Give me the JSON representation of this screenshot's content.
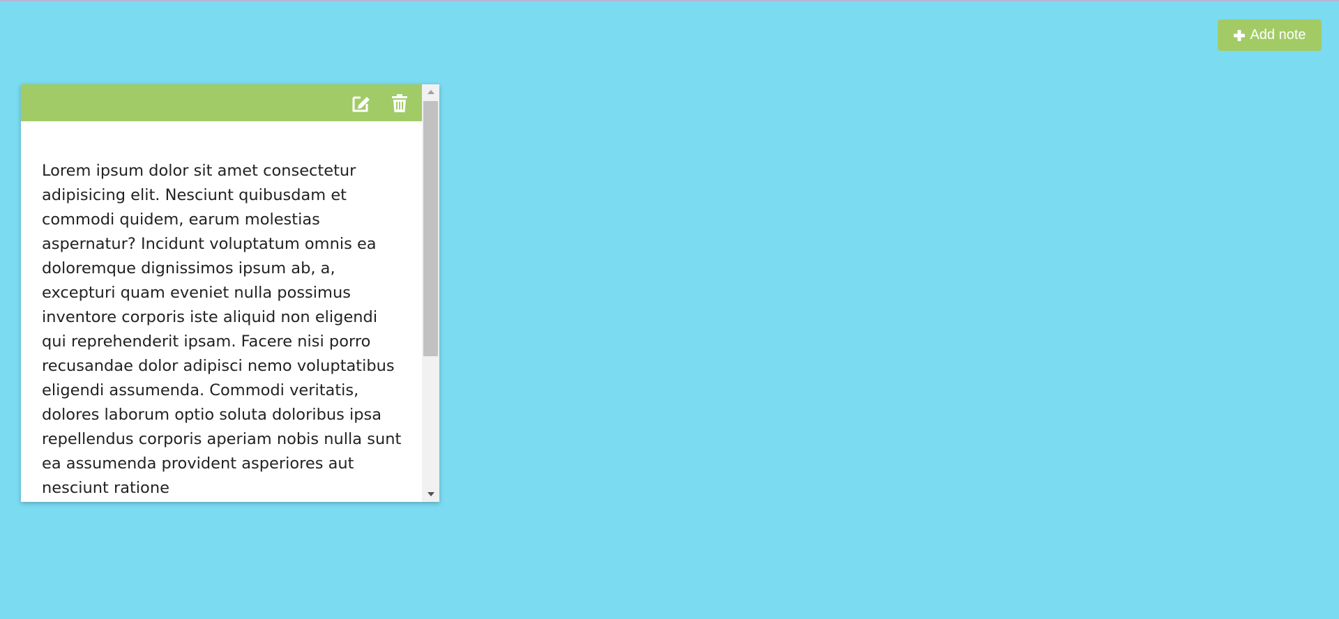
{
  "toolbar": {
    "add_note_label": "Add note",
    "add_icon": "plus-icon"
  },
  "note": {
    "edit_icon": "edit-icon",
    "delete_icon": "trash-icon",
    "text": "Lorem ipsum dolor sit amet consectetur adipisicing elit. Nesciunt quibusdam et commodi quidem, earum molestias aspernatur? Incidunt voluptatum omnis ea doloremque dignissimos ipsum ab, a, excepturi quam eveniet nulla possimus inventore corporis iste aliquid non eligendi qui reprehenderit ipsam. Facere nisi porro recusandae dolor adipisci nemo voluptatibus eligendi assumenda. Commodi veritatis, dolores laborum optio soluta doloribus ipsa repellendus corporis aperiam nobis nulla sunt ea assumenda provident asperiores aut nesciunt ratione"
  },
  "colors": {
    "background": "#7adbf1",
    "accent_green": "#a1cb67",
    "note_background": "#ffffff"
  }
}
